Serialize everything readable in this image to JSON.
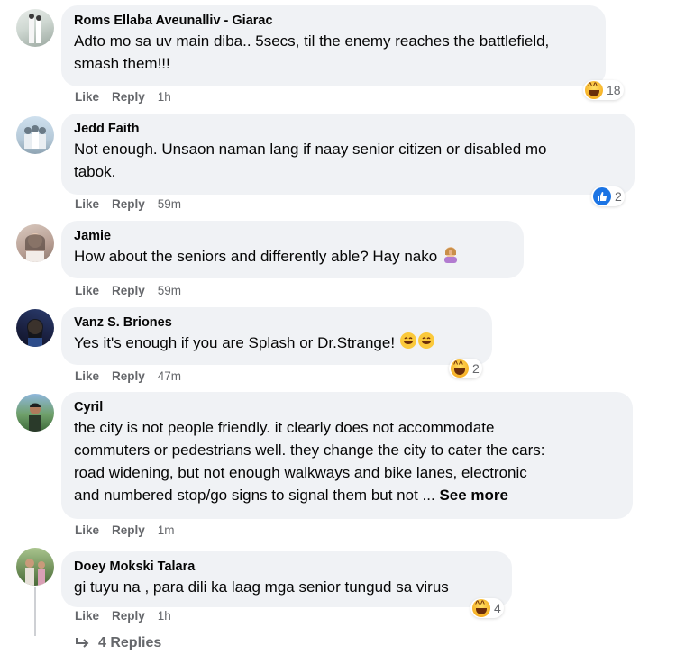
{
  "comments": [
    {
      "author": "Roms Ellaba Aveunalliv - Giarac",
      "lines": [
        "Adto mo sa uv main diba.. 5secs, til the enemy reaches the battlefield,",
        "smash them!!!"
      ],
      "like": "Like",
      "reply": "Reply",
      "time": "1h",
      "reaction": {
        "type": "haha",
        "count": "18"
      }
    },
    {
      "author": "Jedd Faith",
      "lines": [
        "Not enough. Unsaon naman lang if naay senior citizen or disabled mo",
        "tabok."
      ],
      "like": "Like",
      "reply": "Reply",
      "time": "59m",
      "reaction": {
        "type": "like",
        "count": "2"
      }
    },
    {
      "author": "Jamie",
      "lines": [
        "How about the seniors and differently able? Hay nako"
      ],
      "like": "Like",
      "reply": "Reply",
      "time": "59m"
    },
    {
      "author": "Vanz S. Briones",
      "lines": [
        "Yes it's enough if you are Splash or Dr.Strange!"
      ],
      "like": "Like",
      "reply": "Reply",
      "time": "47m",
      "reaction": {
        "type": "haha",
        "count": "2"
      }
    },
    {
      "author": "Cyril",
      "lines": [
        "the city is not people friendly. it clearly does not accommodate",
        "commuters or pedestrians well. they change the city to cater the cars:",
        "road widening, but not enough walkways and bike lanes, electronic",
        "and numbered stop/go signs to signal them but not ..."
      ],
      "see_more": "See more",
      "like": "Like",
      "reply": "Reply",
      "time": "1m"
    },
    {
      "author": "Doey Mokski Talara",
      "lines": [
        "gi tuyu na , para dili ka laag mga senior tungud sa virus"
      ],
      "like": "Like",
      "reply": "Reply",
      "time": "1h",
      "reaction": {
        "type": "haha",
        "count": "4"
      }
    }
  ],
  "replies_label": "4 Replies",
  "colors": {
    "bubble": "#f0f2f5",
    "muted": "#65676b",
    "like_blue": "#1b74e4"
  }
}
